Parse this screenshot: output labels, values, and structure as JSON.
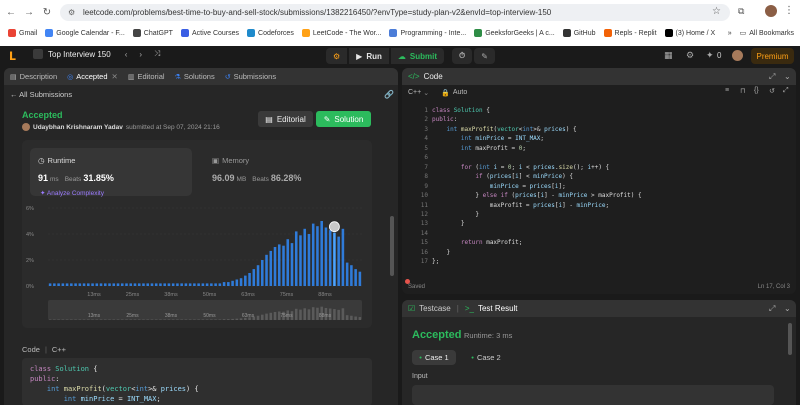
{
  "browser": {
    "url": "leetcode.com/problems/best-time-to-buy-and-sell-stock/submissions/1382216450/?envType=study-plan-v2&envId=top-interview-150",
    "bookmarks": [
      {
        "label": "Gmail",
        "color": "#ea4335"
      },
      {
        "label": "Google Calendar - F...",
        "color": "#4285f4"
      },
      {
        "label": "ChatGPT",
        "color": "#444444"
      },
      {
        "label": "Active Courses",
        "color": "#3a5ee4"
      },
      {
        "label": "Codeforces",
        "color": "#1f8acb"
      },
      {
        "label": "LeetCode - The Wor...",
        "color": "#ffa116"
      },
      {
        "label": "Programming - Inte...",
        "color": "#4c7dd8"
      },
      {
        "label": "GeeksforGeeks | A c...",
        "color": "#2f8d46"
      },
      {
        "label": "GitHub",
        "color": "#333333"
      },
      {
        "label": "Repls - Replit",
        "color": "#f26207"
      },
      {
        "label": "(3) Home / X",
        "color": "#000000"
      }
    ],
    "all_bookmarks": "All Bookmarks"
  },
  "topbar": {
    "problem_list": "Top Interview 150",
    "run": "Run",
    "submit": "Submit",
    "count": "0",
    "premium": "Premium"
  },
  "left": {
    "tabs": [
      {
        "label": "Description",
        "icon": "description-icon"
      },
      {
        "label": "Accepted",
        "icon": "accepted-icon"
      },
      {
        "label": "Editorial",
        "icon": "editorial-icon"
      },
      {
        "label": "Solutions",
        "icon": "solutions-icon"
      },
      {
        "label": "Submissions",
        "icon": "submissions-icon"
      }
    ],
    "all_submissions": "All Submissions",
    "status": "Accepted",
    "author": "Udaybhan Krishnaram Yadav",
    "submitted_at": "submitted at Sep 07, 2024 21:16",
    "editorial_btn": "Editorial",
    "solution_btn": "Solution",
    "runtime": {
      "label": "Runtime",
      "value": "91",
      "unit": "ms",
      "beats_label": "Beats",
      "beats": "31.85%",
      "analyze": "Analyze Complexity"
    },
    "memory": {
      "label": "Memory",
      "value": "96.09",
      "unit": "MB",
      "beats_label": "Beats",
      "beats": "86.28%"
    },
    "code_label": "Code",
    "code_lang": "C++",
    "code_snippet": [
      "class Solution {",
      "public:",
      "    int maxProfit(vector<int>& prices) {",
      "        int minPrice = INT_MAX;"
    ]
  },
  "chart_data": {
    "type": "bar",
    "title": "",
    "xlabel": "",
    "ylabel": "",
    "ylim": [
      0,
      6
    ],
    "yticks": [
      "0%",
      "2%",
      "4%",
      "6%"
    ],
    "xticks": [
      "13ms",
      "25ms",
      "38ms",
      "50ms",
      "63ms",
      "75ms",
      "88ms"
    ],
    "highlight_index": 67,
    "values": [
      0.2,
      0.2,
      0.2,
      0.2,
      0.2,
      0.2,
      0.2,
      0.2,
      0.2,
      0.2,
      0.2,
      0.2,
      0.2,
      0.2,
      0.2,
      0.2,
      0.2,
      0.2,
      0.2,
      0.2,
      0.2,
      0.2,
      0.2,
      0.2,
      0.2,
      0.2,
      0.2,
      0.2,
      0.2,
      0.2,
      0.2,
      0.2,
      0.2,
      0.2,
      0.2,
      0.2,
      0.2,
      0.2,
      0.2,
      0.2,
      0.2,
      0.3,
      0.3,
      0.4,
      0.5,
      0.6,
      0.8,
      1.0,
      1.3,
      1.6,
      2.0,
      2.4,
      2.7,
      3.0,
      3.2,
      3.1,
      3.6,
      3.3,
      4.2,
      3.9,
      4.4,
      4.0,
      4.8,
      4.6,
      5.0,
      4.5,
      4.3,
      4.1,
      3.8,
      4.4,
      1.8,
      1.6,
      1.3,
      1.1
    ],
    "colors": {
      "bar": "#2f7bd9",
      "highlight": "#4aa3ff",
      "grid": "#3a3a3a"
    }
  },
  "editor": {
    "title": "Code",
    "language": "C++",
    "mode": "Auto",
    "lines": [
      "class Solution {",
      "public:",
      "    int maxProfit(vector<int>& prices) {",
      "        int minPrice = INT_MAX;",
      "        int maxProfit = 0;",
      "",
      "        for (int i = 0; i < prices.size(); i++) {",
      "            if (prices[i] < minPrice) {",
      "                minPrice = prices[i];",
      "            } else if (prices[i] - minPrice > maxProfit) {",
      "                maxProfit = prices[i] - minPrice;",
      "            }",
      "        }",
      "",
      "        return maxProfit;",
      "    }",
      "};"
    ],
    "saved": "Saved",
    "cursor": "Ln 17, Col 3"
  },
  "test": {
    "testcase_tab": "Testcase",
    "result_tab": "Test Result",
    "status": "Accepted",
    "runtime": "Runtime: 3 ms",
    "case1": "Case 1",
    "case2": "Case 2",
    "input_label": "Input"
  }
}
